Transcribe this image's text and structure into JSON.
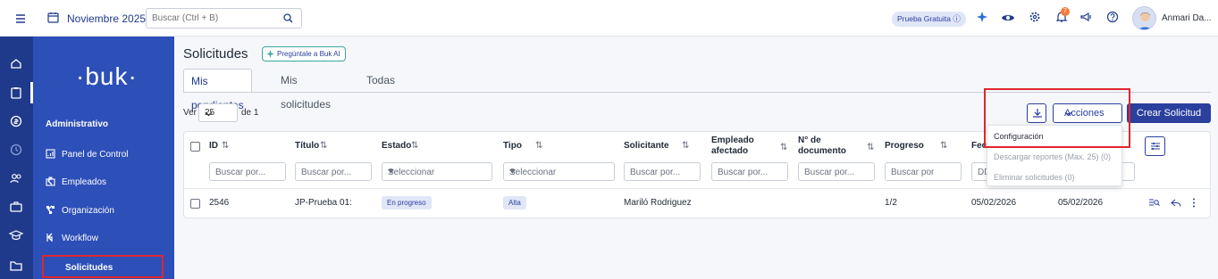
{
  "topbar": {
    "date": "Noviembre 2025",
    "search_placeholder": "Buscar (Ctrl + B)",
    "trial_label": "Prueba Gratuita ⓘ",
    "notif_count": "7",
    "user_name": "Anmari Da..."
  },
  "sidebar": {
    "logo": "·buk·",
    "section": "Administrativo",
    "items": [
      {
        "label": "Panel de Control",
        "icon": "dashboard-icon"
      },
      {
        "label": "Empleados",
        "icon": "employees-icon"
      },
      {
        "label": "Organización",
        "icon": "org-chart-icon"
      },
      {
        "label": "Workflow",
        "icon": "workflow-icon"
      }
    ],
    "sub_active": "Solicitudes"
  },
  "main": {
    "title": "Solicitudes",
    "ai_button": "Pregúntale a Buk AI",
    "tabs": [
      "Mis pendientes",
      "Mis solicitudes",
      "Todas"
    ],
    "ver_label": "Ver",
    "ver_value": "25",
    "page_of": "de 1",
    "acciones": "Acciones",
    "crear": "Crear Solicitud"
  },
  "table": {
    "columns": [
      "ID",
      "Título",
      "Estado",
      "Tipo",
      "Solicitante",
      "Empleado afectado",
      "N° de documento",
      "Progreso",
      "Fec",
      ""
    ],
    "column_line1": {
      "empleado": "Empleado",
      "documento": "N° de"
    },
    "column_line2": {
      "empleado": "afectado",
      "documento": "documento"
    },
    "filters": {
      "buscar": "Buscar por...",
      "buscar_short": "Buscar por",
      "seleccionar": "Seleccionar",
      "fecha_placeholder": "DD"
    },
    "rows": [
      {
        "id": "2546",
        "titulo": "JP-Prueba 01:",
        "estado": "En progreso",
        "tipo": "Alta",
        "solicitante": "Mariló Rodriguez",
        "empleado": "",
        "documento": "",
        "progreso": "1/2",
        "fecha1": "05/02/2026",
        "fecha2": "05/02/2026"
      }
    ]
  },
  "dropdown": {
    "items": [
      {
        "label": "Configuración",
        "enabled": true
      },
      {
        "label": "Descargar reportes (Max. 25) (0)",
        "enabled": false
      },
      {
        "label": "Eliminar solicitudes (0)",
        "enabled": false
      }
    ]
  },
  "colors": {
    "primary": "#2a3f9e",
    "sidebar_rail": "#1f3a8a",
    "sidebar_panel": "#2d4fb8",
    "highlight": "#e0262e"
  }
}
